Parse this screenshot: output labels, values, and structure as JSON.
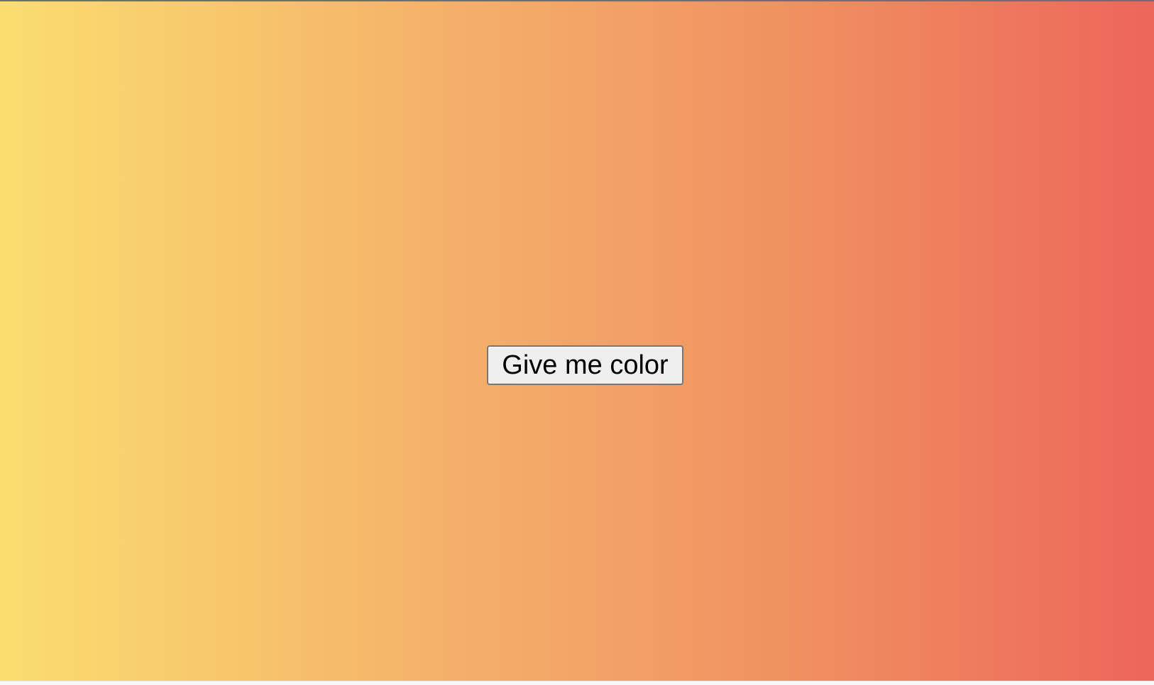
{
  "app": {
    "background": {
      "type": "linear-gradient",
      "direction": "left-to-right",
      "colors": [
        "#fbdd6f",
        "#f4af6a",
        "#f08f61",
        "#ed665a"
      ]
    }
  },
  "main": {
    "button_label": "Give me color"
  }
}
